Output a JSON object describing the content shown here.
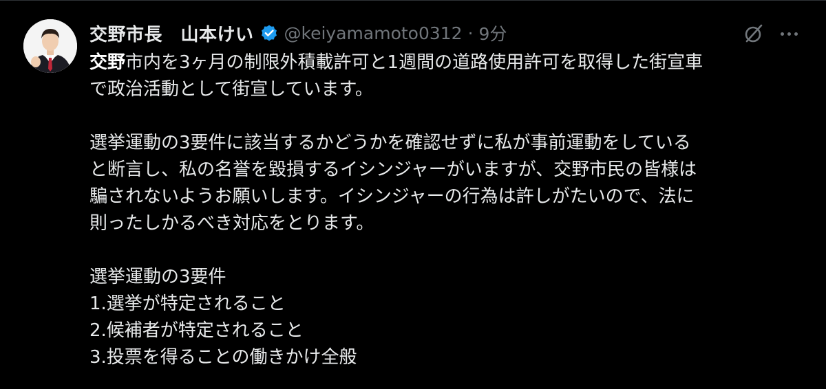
{
  "author": {
    "display_name": "交野市長　山本けい",
    "handle": "@keiyamamoto0312",
    "separator": "·",
    "timestamp": "9分",
    "verified_color": "#1d9bf0"
  },
  "icons": {
    "verified": "verified-badge-icon",
    "grok": "grok-icon",
    "more": "more-options-icon"
  },
  "tweet": {
    "line1_highlight": "交野",
    "line1_rest": "市内を3ヶ月の制限外積載許可と1週間の道路使用許可を取得した街宣車",
    "line2": "で政治活動として街宣しています。",
    "line3": "選挙運動の3要件に該当するかどうかを確認せずに私が事前運動をしている",
    "line4": "と断言し、私の名誉を毀損するイシンジャーがいますが、交野市民の皆様は",
    "line5": "騙されないようお願いします。イシンジャーの行為は許しがたいので、法に",
    "line6": "則ったしかるべき対応をとります。",
    "line7": "選挙運動の3要件",
    "line8": "1.選挙が特定されること",
    "line9": "2.候補者が特定されること",
    "line10": "3.投票を得ることの働きかけ全般"
  },
  "colors": {
    "background": "#000000",
    "text": "#e7e9ea",
    "muted": "#71767b"
  }
}
